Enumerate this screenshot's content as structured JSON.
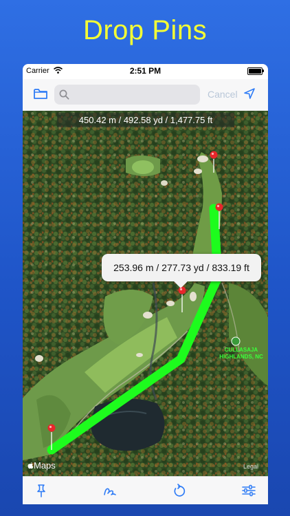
{
  "headline": "Drop Pins",
  "status_bar": {
    "carrier": "Carrier",
    "time": "2:51 PM",
    "battery_level": 1.0
  },
  "toolbar": {
    "search_placeholder": "",
    "cancel_label": "Cancel"
  },
  "map": {
    "total_distance": "450.42 m / 492.58 yd / 1,477.75 ft",
    "segment_distance": "253.96 m / 277.73 yd / 833.19 ft",
    "place_label_line1": "CULLASAJA",
    "place_label_line2": "HIGHLANDS, NC",
    "brand": "Maps",
    "legal": "Legal"
  },
  "colors": {
    "accent": "#2f7cf6",
    "route": "#1dfc1d",
    "headline": "#f4ff35",
    "pin": "#e8262b"
  },
  "icons": [
    "folder-icon",
    "search-icon",
    "location-arrow-icon",
    "pin-icon",
    "draw-icon",
    "undo-icon",
    "settings-sliders-icon"
  ]
}
